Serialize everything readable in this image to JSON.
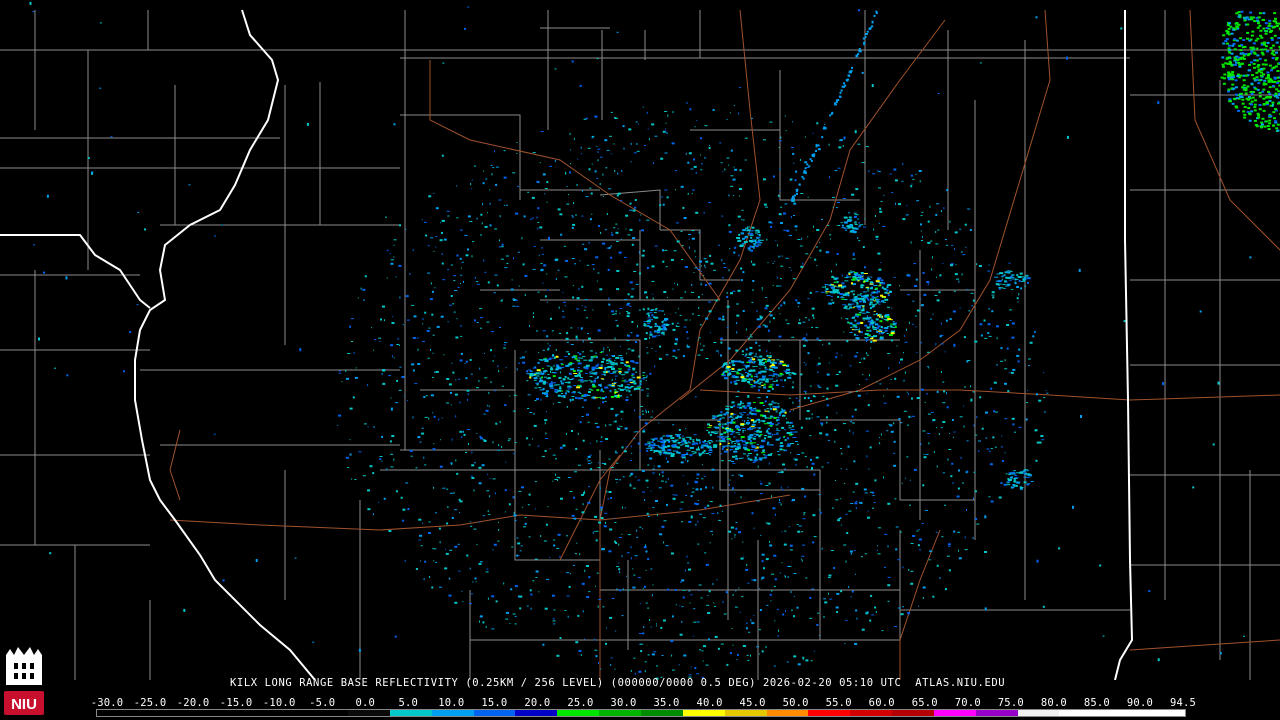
{
  "product_title": "KILX LONG RANGE BASE REFLECTIVITY (0.25KM / 256 LEVEL) (000000/0000 0.5 DEG) 2026-02-20 05:10 UTC  ATLAS.NIU.EDU",
  "logo_text": "NIU",
  "scale": {
    "ticks": [
      "-30.0",
      "-25.0",
      "-20.0",
      "-15.0",
      "-10.0",
      "-5.0",
      "0.0",
      "5.0",
      "10.0",
      "15.0",
      "20.0",
      "25.0",
      "30.0",
      "35.0",
      "40.0",
      "45.0",
      "50.0",
      "55.0",
      "60.0",
      "65.0",
      "70.0",
      "75.0",
      "80.0",
      "85.0",
      "90.0",
      "94.5"
    ],
    "colors": [
      "#000000",
      "#000000",
      "#000000",
      "#000000",
      "#000000",
      "#000000",
      "#0a0a0a",
      "#00c8c8",
      "#00a0f0",
      "#0064f0",
      "#0000c8",
      "#00e600",
      "#00b400",
      "#008c00",
      "#ffff00",
      "#e6c800",
      "#ff8c00",
      "#ff0000",
      "#d20000",
      "#b40000",
      "#ff00ff",
      "#9600c8",
      "#f0f0f0",
      "#ffffff",
      "#ffffff",
      "#ffffff"
    ]
  },
  "colors": {
    "background": "#000000",
    "county_lines": "#8c8c8c",
    "state_lines": "#ffffff",
    "highways": "#a0522d"
  }
}
